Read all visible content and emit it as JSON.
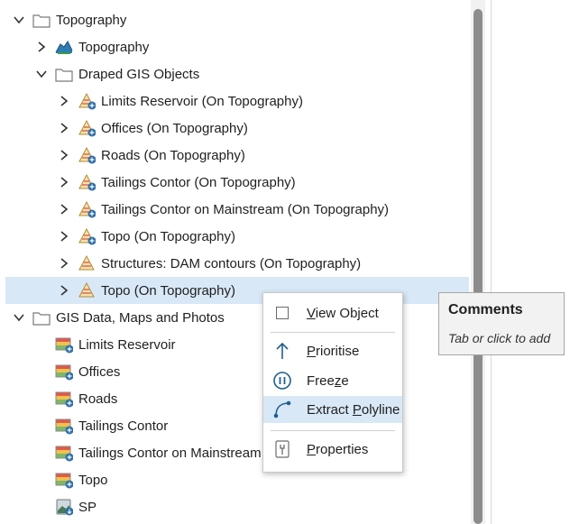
{
  "tree": {
    "root": {
      "label": "Topography"
    },
    "topography_item": {
      "label": "Topography"
    },
    "draped_folder": {
      "label": "Draped GIS Objects"
    },
    "draped_items": [
      "Limits Reservoir (On Topography)",
      "Offices (On Topography)",
      "Roads (On Topography)",
      "Tailings Contor (On Topography)",
      "Tailings Contor on Mainstream (On Topography)",
      "Topo (On Topography)",
      "Structures: DAM contours (On Topography)",
      "Topo (On Topography)"
    ],
    "gis_folder": {
      "label": "GIS Data, Maps and Photos"
    },
    "gis_items": [
      "Limits Reservoir",
      "Offices",
      "Roads",
      "Tailings Contor",
      "Tailings Contor on Mainstream",
      "Topo",
      "SP"
    ]
  },
  "context_menu": {
    "view_object": {
      "pre": "",
      "key": "V",
      "post": "iew Object"
    },
    "prioritise": {
      "pre": "",
      "key": "P",
      "post": "rioritise"
    },
    "freeze": {
      "pre": "Free",
      "key": "z",
      "post": "e"
    },
    "extract_polyline": {
      "pre": "Extract ",
      "key": "P",
      "post": "olyline"
    },
    "properties": {
      "pre": "",
      "key": "P",
      "post": "roperties"
    }
  },
  "tooltip": {
    "title": "Comments",
    "subtitle": "Tab or click to add"
  },
  "colors": {
    "selection": "#d8e8f7",
    "accent": "#1f5f8f",
    "scrollbar": "#8c8c8c"
  }
}
